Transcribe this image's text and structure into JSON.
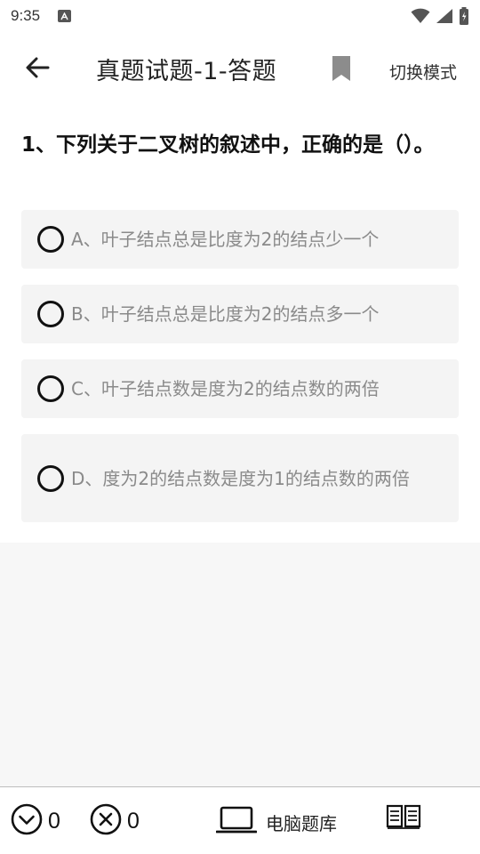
{
  "status_bar": {
    "time": "9:35",
    "icons": [
      "a-notification-icon",
      "wifi-icon",
      "signal-icon",
      "battery-icon"
    ]
  },
  "app_bar": {
    "title": "真题试题-1-答题",
    "switch_mode_label": "切换模式",
    "icons": [
      "arrow-left-icon",
      "bookmark-icon"
    ]
  },
  "question": {
    "text": "1、下列关于二叉树的叙述中，正确的是（）。",
    "options": [
      {
        "label": "A、叶子结点总是比度为2的结点少一个"
      },
      {
        "label": "B、叶子结点总是比度为2的结点多一个"
      },
      {
        "label": "C、叶子结点数是度为2的结点数的两倍"
      },
      {
        "label": "D、度为2的结点数是度为1的结点数的两倍"
      }
    ]
  },
  "footer": {
    "correct_count": "0",
    "wrong_count": "0",
    "pc_bank_label": "电脑题库",
    "icons": [
      "check-circle-icon",
      "x-circle-icon",
      "laptop-icon",
      "book-icon"
    ]
  }
}
